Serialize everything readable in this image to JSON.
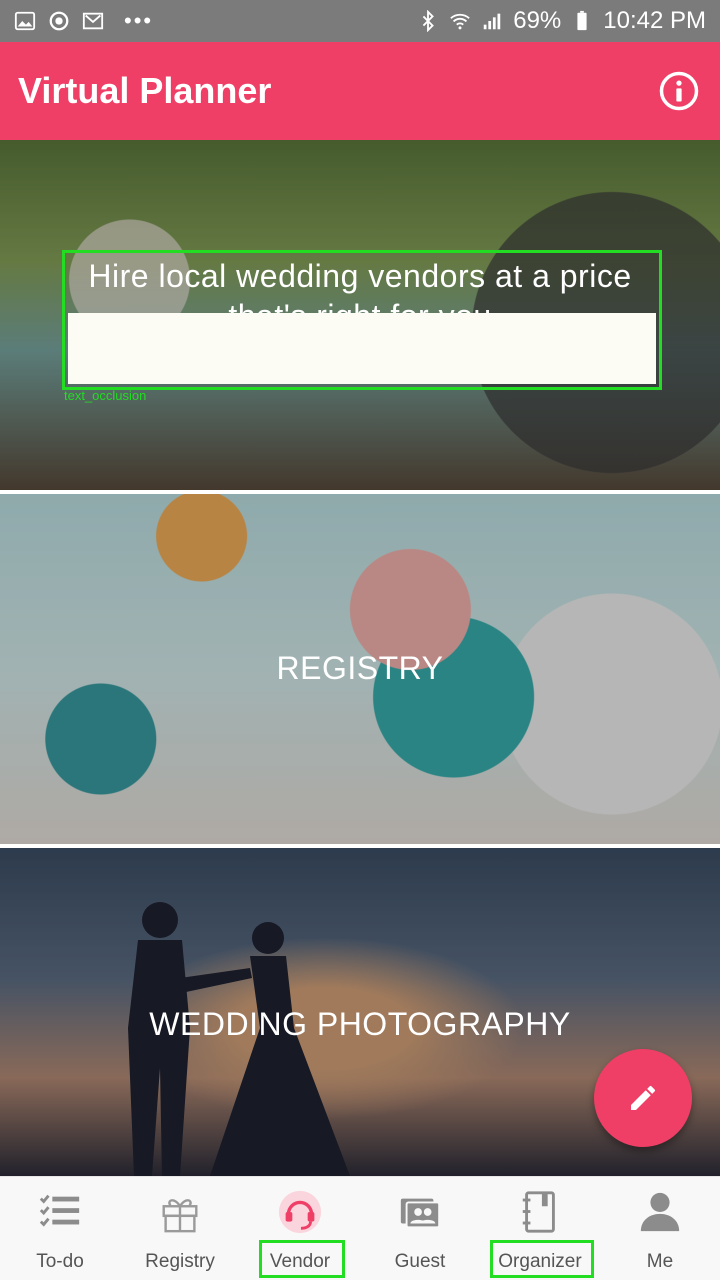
{
  "status_bar": {
    "battery": "69%",
    "time": "10:42 PM",
    "more_indicator": "•••",
    "icons": [
      "image-icon",
      "sync-icon",
      "mail-icon",
      "bluetooth-icon",
      "wifi-icon",
      "signal-icon",
      "battery-icon"
    ]
  },
  "app_bar": {
    "title": "Virtual Planner",
    "info_icon": "info-icon"
  },
  "cards": [
    {
      "label": "Hire local wedding vendors at a price that's right for you"
    },
    {
      "label": "REGISTRY"
    },
    {
      "label": "WEDDING PHOTOGRAPHY"
    }
  ],
  "occlusion": {
    "label": "text_occlusion"
  },
  "fab": {
    "icon": "pencil-icon"
  },
  "bottom_nav": {
    "items": [
      {
        "label": "To-do",
        "icon": "checklist-icon"
      },
      {
        "label": "Registry",
        "icon": "gift-icon"
      },
      {
        "label": "Vendor",
        "icon": "headset-icon",
        "active": true
      },
      {
        "label": "Guest",
        "icon": "guests-icon"
      },
      {
        "label": "Organizer",
        "icon": "notebook-icon"
      },
      {
        "label": "Me",
        "icon": "person-icon"
      }
    ]
  },
  "colors": {
    "brand": "#ef3f66",
    "status_bar": "#7b7b7b",
    "highlight": "#22dd22"
  }
}
